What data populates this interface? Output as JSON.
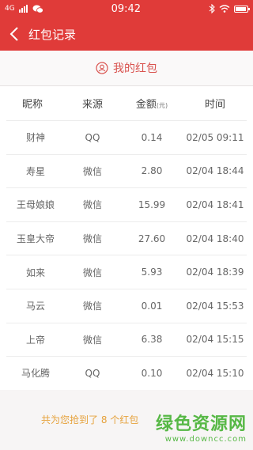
{
  "status_bar": {
    "network": "4G",
    "time": "09:42"
  },
  "nav": {
    "title": "红包记录"
  },
  "section": {
    "title": "我的红包"
  },
  "table": {
    "headers": {
      "nickname": "昵称",
      "source": "来源",
      "amount": "金额",
      "amount_unit": "(元)",
      "time": "时间"
    },
    "rows": [
      {
        "nickname": "财神",
        "source": "QQ",
        "amount": "0.14",
        "time": "02/05 09:11"
      },
      {
        "nickname": "寿星",
        "source": "微信",
        "amount": "2.80",
        "time": "02/04 18:44"
      },
      {
        "nickname": "王母娘娘",
        "source": "微信",
        "amount": "15.99",
        "time": "02/04 18:41"
      },
      {
        "nickname": "玉皇大帝",
        "source": "微信",
        "amount": "27.60",
        "time": "02/04 18:40"
      },
      {
        "nickname": "如来",
        "source": "微信",
        "amount": "5.93",
        "time": "02/04 18:39"
      },
      {
        "nickname": "马云",
        "source": "微信",
        "amount": "0.01",
        "time": "02/04 15:53"
      },
      {
        "nickname": "上帝",
        "source": "微信",
        "amount": "6.38",
        "time": "02/04 15:15"
      },
      {
        "nickname": "马化腾",
        "source": "QQ",
        "amount": "0.10",
        "time": "02/04 15:10"
      }
    ]
  },
  "summary": {
    "text": "共为您抢到了 8 个红包"
  },
  "watermark": {
    "title": "绿色资源网",
    "url": "www.downcc.com"
  },
  "icons": {
    "back": "chevron-left-icon",
    "section": "red-packet-icon"
  },
  "colors": {
    "primary": "#e03b39",
    "accent_text": "#d9534f",
    "summary": "#e6a23c",
    "watermark": "#57b846"
  }
}
